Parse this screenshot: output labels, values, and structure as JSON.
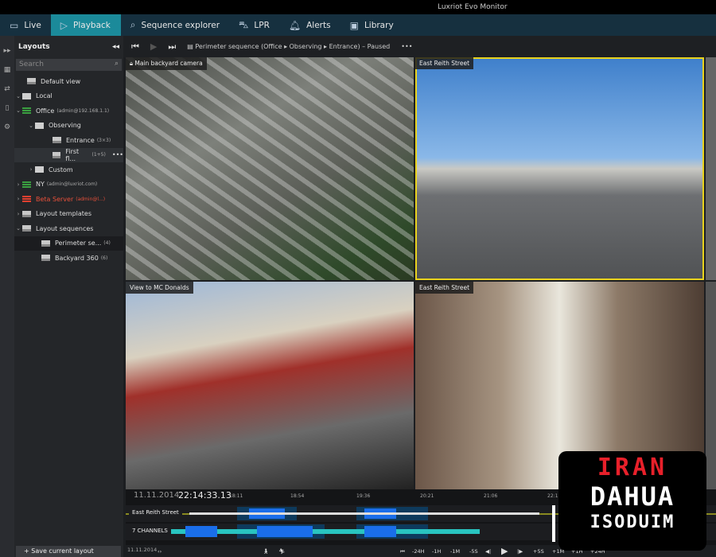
{
  "window": {
    "title": "Luxriot Evo Monitor"
  },
  "nav": [
    {
      "label": "Live",
      "icon": "monitor-icon"
    },
    {
      "label": "Playback",
      "icon": "play-icon",
      "active": true
    },
    {
      "label": "Sequence explorer",
      "icon": "sequence-icon"
    },
    {
      "label": "LPR",
      "icon": "car-icon"
    },
    {
      "label": "Alerts",
      "icon": "bell-icon"
    },
    {
      "label": "Library",
      "icon": "library-icon"
    }
  ],
  "sidebar": {
    "title": "Layouts",
    "search_placeholder": "Search",
    "items": [
      {
        "label": "Default view",
        "sub": ""
      },
      {
        "label": "Local",
        "sub": ""
      },
      {
        "label": "Office",
        "sub": "(admin@192.168.1.1)"
      },
      {
        "label": "Observing",
        "sub": ""
      },
      {
        "label": "Entrance",
        "sub": "(3×3)"
      },
      {
        "label": "First fl...",
        "sub": "(1+5)"
      },
      {
        "label": "Custom",
        "sub": ""
      },
      {
        "label": "NY",
        "sub": "(admin@luxriot.com)"
      },
      {
        "label": "Beta Server",
        "sub": "(admin@l...)"
      },
      {
        "label": "Layout templates",
        "sub": ""
      },
      {
        "label": "Layout sequences",
        "sub": ""
      },
      {
        "label": "Perimeter se...",
        "sub": "(4)"
      },
      {
        "label": "Backyard 360",
        "sub": "(6)"
      }
    ],
    "save_label": "Save current layout"
  },
  "toolbar": {
    "sequence": "Perimeter sequence (Office ▸ Observing ▸ Entrance) – Paused"
  },
  "cameras": [
    {
      "label": "Main backyard camera",
      "locked": true
    },
    {
      "label": "East Reith Street",
      "selected": true
    },
    {
      "label": "View to MC Donalds"
    },
    {
      "label": "East Reith Street"
    }
  ],
  "timeline": {
    "date": "11.11.2014",
    "time": "22:14:33.13",
    "ticks": [
      "18:11",
      "18:54",
      "19:36",
      "20:21",
      "21:06",
      "22:12"
    ],
    "tracks": [
      "East Reith Street",
      "7 CHANNELS"
    ],
    "bottom_date": "11.11.2014",
    "controls": [
      "-24H",
      "-1H",
      "-1M",
      "-5S",
      "+5S",
      "+1M",
      "+1H",
      "+24H"
    ]
  },
  "colors": {
    "accent": "#1b8a9a",
    "selected_cell": "#e8d21d",
    "recording": "#1a6eea",
    "motion": "#29c4c0"
  },
  "watermark": {
    "lines": [
      "IRAN",
      "DAHUA",
      "ISODUIM"
    ]
  }
}
